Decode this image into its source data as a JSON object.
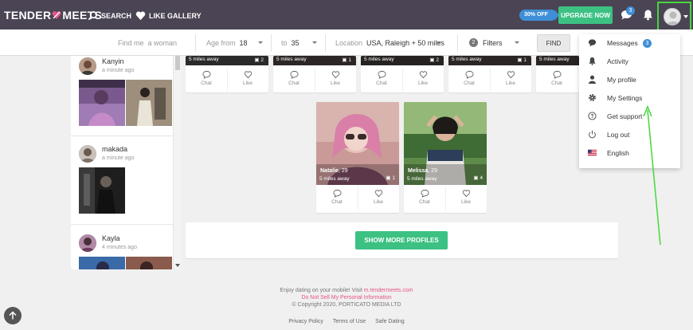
{
  "brand": {
    "logo_left": "TENDER",
    "logo_right": "MEETS"
  },
  "nav": {
    "search": "SEARCH",
    "gallery": "LIKE GALLERY"
  },
  "header": {
    "discount": "30% OFF",
    "upgrade": "UPGRADE NOW",
    "message_count": "3"
  },
  "filters": {
    "find_me_label": "Find me",
    "find_me_value": "a woman",
    "age_from_label": "Age from",
    "age_from_value": "18",
    "age_to_label": "to",
    "age_to_value": "35",
    "location_label": "Location",
    "location_value": "USA, Raleigh + 50 miles",
    "filters_count": "2",
    "filters_label": "Filters",
    "find_button": "FIND"
  },
  "feed": [
    {
      "name": "Kanyin",
      "time": "a minute ago"
    },
    {
      "name": "makada",
      "time": "a minute ago"
    },
    {
      "name": "Kayla",
      "time": "4 minutes ago"
    }
  ],
  "cards_top": [
    {
      "distance": "5 miles away",
      "photos": "2",
      "chat": "Chat",
      "like": "Like"
    },
    {
      "distance": "5 miles away",
      "photos": "1",
      "chat": "Chat",
      "like": "Like"
    },
    {
      "distance": "5 miles away",
      "photos": "2",
      "chat": "Chat",
      "like": "Like"
    },
    {
      "distance": "5 miles away",
      "photos": "1",
      "chat": "Chat",
      "like": "Like"
    },
    {
      "distance": "5 miles away",
      "chat": "Chat"
    }
  ],
  "cards": [
    {
      "name": "Natalie",
      "age": ", 29",
      "distance": "5 miles away",
      "photos": "1",
      "chat": "Chat",
      "like": "Like"
    },
    {
      "name": "Melissa",
      "age": ", 29",
      "distance": "5 miles away",
      "photos": "4",
      "chat": "Chat",
      "like": "Like"
    }
  ],
  "show_more": "SHOW MORE PROFILES",
  "footer": {
    "line1_prefix": "Enjoy dating on your mobile! Visit",
    "line1_link": "m.tendermeets.com",
    "line2": "Do Not Sell My Personal Information",
    "line3": "© Copyright 2020, PORTICATO MEDIA LTD",
    "links": [
      "Privacy Policy",
      "Terms of Use",
      "Safe Dating"
    ]
  },
  "dropdown": {
    "items": [
      {
        "label": "Messages",
        "icon": "chat-bubble-icon",
        "count": "3"
      },
      {
        "label": "Activity",
        "icon": "bell-icon"
      },
      {
        "label": "My profile",
        "icon": "person-icon"
      },
      {
        "label": "My Settings",
        "icon": "gear-icon"
      },
      {
        "label": "Get support",
        "icon": "question-icon"
      },
      {
        "label": "Log out",
        "icon": "power-icon"
      },
      {
        "label": "English",
        "icon": "us-flag-icon"
      }
    ]
  },
  "colors": {
    "topbar": "#4a4454",
    "accent_green": "#3cc183",
    "accent_blue": "#3f8fd8",
    "link_pink": "#e4548a",
    "highlight": "#46d63c"
  }
}
